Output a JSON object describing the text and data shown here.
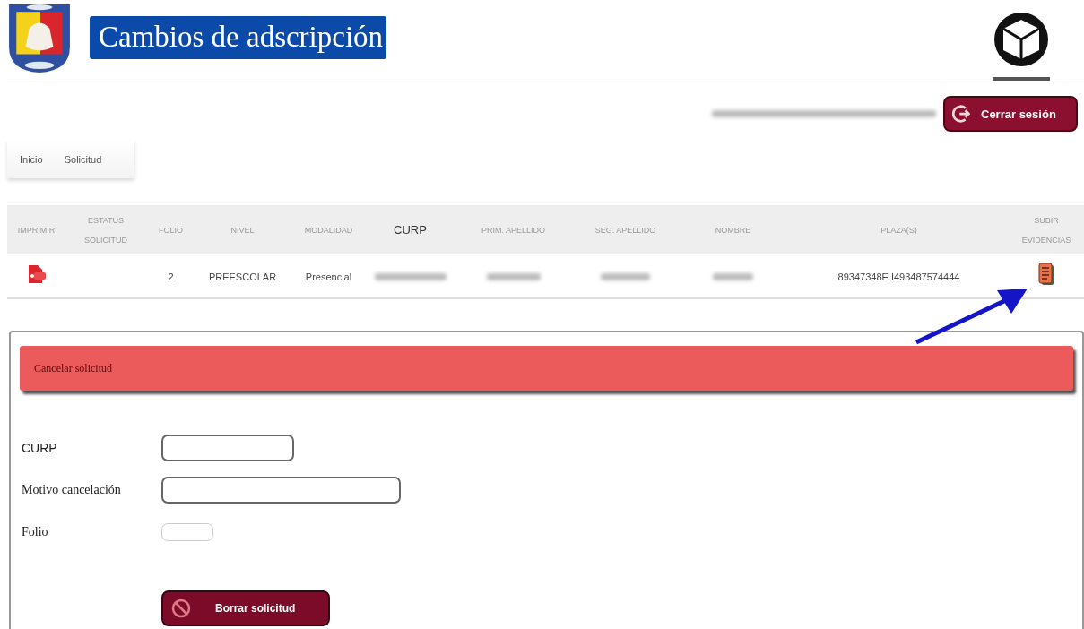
{
  "header": {
    "title": "Cambios de adscripción"
  },
  "session": {
    "logout_button": "Cerrar sesión"
  },
  "nav": {
    "items": [
      "Inicio",
      "Solicitud"
    ]
  },
  "table": {
    "columns": [
      "IMPRIMIR",
      "ESTATUS SOLICITUD",
      "FOLIO",
      "NIVEL",
      "MODALIDAD",
      "CURP",
      "PRIM. APELLIDO",
      "SEG. APELLIDO",
      "NOMBRE",
      "PLAZA(S)",
      "SUBIR EVIDENCIAS"
    ],
    "rows": [
      {
        "cells": [
          {
            "kind": "print-icon"
          },
          {
            "kind": "empty"
          },
          {
            "kind": "text",
            "text": "2"
          },
          {
            "kind": "text",
            "text": "PREESCOLAR"
          },
          {
            "kind": "text",
            "text": "Presencial"
          },
          {
            "kind": "redacted"
          },
          {
            "kind": "redacted"
          },
          {
            "kind": "redacted"
          },
          {
            "kind": "redacted"
          },
          {
            "kind": "text",
            "text": "89347348E I493487574444"
          },
          {
            "kind": "upload-icon"
          }
        ]
      }
    ]
  },
  "cancel_panel": {
    "title": "Cancelar solicitud",
    "fields": [
      "CURP",
      "Motivo cancelación",
      "Folio"
    ],
    "submit_button": "Borrar solicitud"
  }
}
